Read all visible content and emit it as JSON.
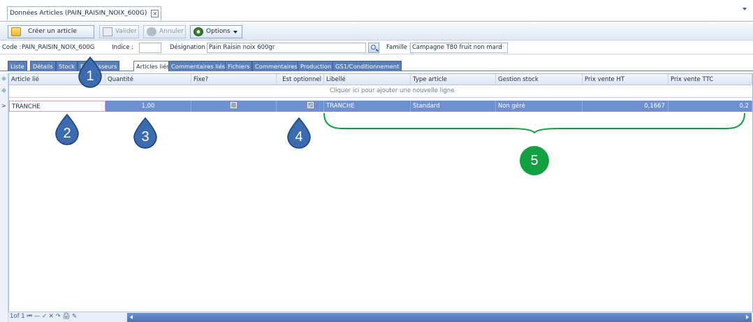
{
  "document_tab": {
    "title": "Données Articles (PAIN_RAISIN_NOIX_600G)",
    "close_glyph": "×"
  },
  "toolbar": {
    "create_label": "Créer un article",
    "validate_label": "Valider",
    "cancel_label": "Annuler",
    "options_label": "Options"
  },
  "fields": {
    "code_label": "Code :",
    "code_value": "PAIN_RAISIN_NOIX_600G",
    "indice_label": "Indice :",
    "indice_value": "",
    "designation_label": "Désignation :",
    "designation_value": "Pain Raisin noix 600gr",
    "famille_label": "Famille :",
    "famille_value": "Campagne T80 fruit non mard",
    "famille_button": "···"
  },
  "subtabs": [
    "Liste",
    "Détails",
    "Stock",
    "Fournisseurs",
    "Articles liés",
    "Commentaires liés",
    "Fichiers",
    "Commentaires",
    "Production",
    "GS1/Conditionnement"
  ],
  "active_subtab": "Articles liés",
  "grid": {
    "columns": [
      "Article lié",
      "Quantité",
      "Fixe?",
      "Est optionnel",
      "Libellé",
      "Type article",
      "Gestion stock",
      "Prix vente HT",
      "Prix vente TTC"
    ],
    "new_row_hint": "Cliquer ici pour ajouter une nouvelle ligne",
    "rows": [
      {
        "article": "TRANCHE",
        "quantite": "1,00",
        "fixe": false,
        "optionnel": true,
        "libelle": "TRANCHE",
        "type": "Standard",
        "gestion": "Non géré",
        "prix_ht": "0,1667",
        "prix_ttc": "0,2"
      }
    ]
  },
  "navigator": {
    "record_text": "1of 1",
    "icons": "⏮ — ✓ ✕ ↷ 🖨 ✎"
  },
  "callouts": [
    "1",
    "2",
    "3",
    "4",
    "5"
  ],
  "colors": {
    "accent_blue": "#5b7fb9",
    "selected_row": "#6f8fd0",
    "callout_blue": "#3c6bb0",
    "callout_green": "#12a040"
  }
}
